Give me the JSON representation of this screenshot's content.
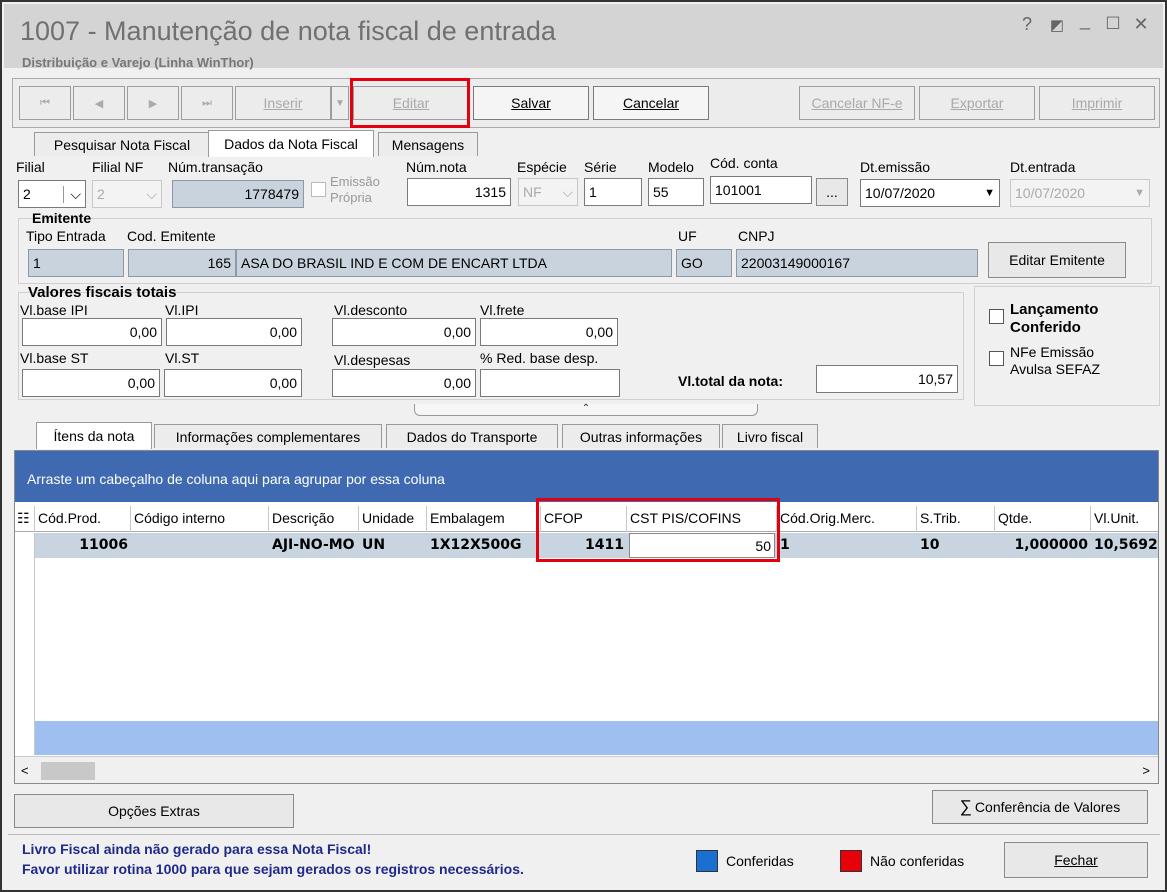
{
  "window": {
    "title": "1007 - Manutenção de nota fiscal de entrada",
    "subtitle": "Distribuição e Varejo (Linha WinThor)",
    "controls": [
      "?",
      "▪",
      "_",
      "☐",
      "✕"
    ]
  },
  "toolbar": {
    "nav": [
      "⏮",
      "◀",
      "▶",
      "⏭"
    ],
    "inserir": "Inserir",
    "editar": "Editar",
    "salvar": "Salvar",
    "cancelar": "Cancelar",
    "cancelar_nfe": "Cancelar NF-e",
    "exportar": "Exportar",
    "imprimir": "Imprimir"
  },
  "tabs_top": [
    "Pesquisar Nota Fiscal",
    "Dados da Nota Fiscal",
    "Mensagens"
  ],
  "header_fields": {
    "filial_label": "Filial",
    "filial": "2",
    "filial_nf_label": "Filial NF",
    "filial_nf": "2",
    "num_transacao_label": "Núm.transação",
    "num_transacao": "1778479",
    "emissao_propria": "Emissão Própria",
    "num_nota_label": "Núm.nota",
    "num_nota": "1315",
    "especie_label": "Espécie",
    "especie": "NF",
    "serie_label": "Série",
    "serie": "1",
    "modelo_label": "Modelo",
    "modelo": "55",
    "cod_conta_label": "Cód. conta",
    "cod_conta": "101001",
    "ellipsis": "...",
    "dt_emissao_label": "Dt.emissão",
    "dt_emissao": "10/07/2020",
    "dt_entrada_label": "Dt.entrada",
    "dt_entrada": "10/07/2020"
  },
  "emitente": {
    "title": "Emitente",
    "tipo_entrada_label": "Tipo Entrada",
    "tipo_entrada": "1",
    "cod_emitente_label": "Cod. Emitente",
    "cod_emitente": "165",
    "nome": "ASA DO BRASIL IND E COM DE ENCART LTDA",
    "uf_label": "UF",
    "uf": "GO",
    "cnpj_label": "CNPJ",
    "cnpj": "22003149000167",
    "editar_button": "Editar Emitente"
  },
  "valores": {
    "title": "Valores fiscais totais",
    "vl_base_ipi_label": "Vl.base IPI",
    "vl_base_ipi": "0,00",
    "vl_ipi_label": "Vl.IPI",
    "vl_ipi": "0,00",
    "vl_desconto_label": "Vl.desconto",
    "vl_desconto": "0,00",
    "vl_frete_label": "Vl.frete",
    "vl_frete": "0,00",
    "vl_base_st_label": "Vl.base ST",
    "vl_base_st": "0,00",
    "vl_st_label": "Vl.ST",
    "vl_st": "0,00",
    "vl_despesas_label": "Vl.despesas",
    "vl_despesas": "0,00",
    "red_base_label": "% Red. base desp.",
    "red_base": "",
    "vl_total_label": "Vl.total da nota:",
    "vl_total": "10,57"
  },
  "checks": {
    "lancamento": "Lançamento Conferido",
    "nfe_avulsa": "NFe Emissão Avulsa SEFAZ"
  },
  "tabs_bottom": [
    "Ítens da nota",
    "Informações complementares",
    "Dados do Transporte",
    "Outras informações",
    "Livro fiscal"
  ],
  "grid": {
    "group_hint": "Arraste um cabeçalho de coluna aqui para agrupar por essa coluna",
    "columns": [
      "Cód.Prod.",
      "Código interno",
      "Descrição",
      "Unidade",
      "Embalagem",
      "CFOP",
      "CST PIS/COFINS",
      "Cód.Orig.Merc.",
      "S.Trib.",
      "Qtde.",
      "Vl.Unit."
    ],
    "row": {
      "cod_prod": "11006",
      "codigo_interno": "",
      "descricao": "AJI-NO-MO",
      "unidade": "UN",
      "embalagem": "1X12X500G",
      "cfop": "1411",
      "cst": "50",
      "orig": "1",
      "strib": "10",
      "qtde": "1,000000",
      "vl_unit": "10,5692"
    }
  },
  "bottom": {
    "opcoes_extras": "Opções Extras",
    "conferencia": "Conferência de Valores",
    "msg1": "Livro Fiscal ainda não gerado para essa Nota Fiscal!",
    "msg2": "Favor utilizar rotina 1000 para que sejam gerados os registros necessários.",
    "conferidas": "Conferidas",
    "nao_conferidas": "Não conferidas",
    "fechar": "Fechar"
  },
  "colors": {
    "conferidas": "#1a6fd1",
    "nao_conferidas": "#e8000b",
    "highlight": "#e3000f"
  }
}
